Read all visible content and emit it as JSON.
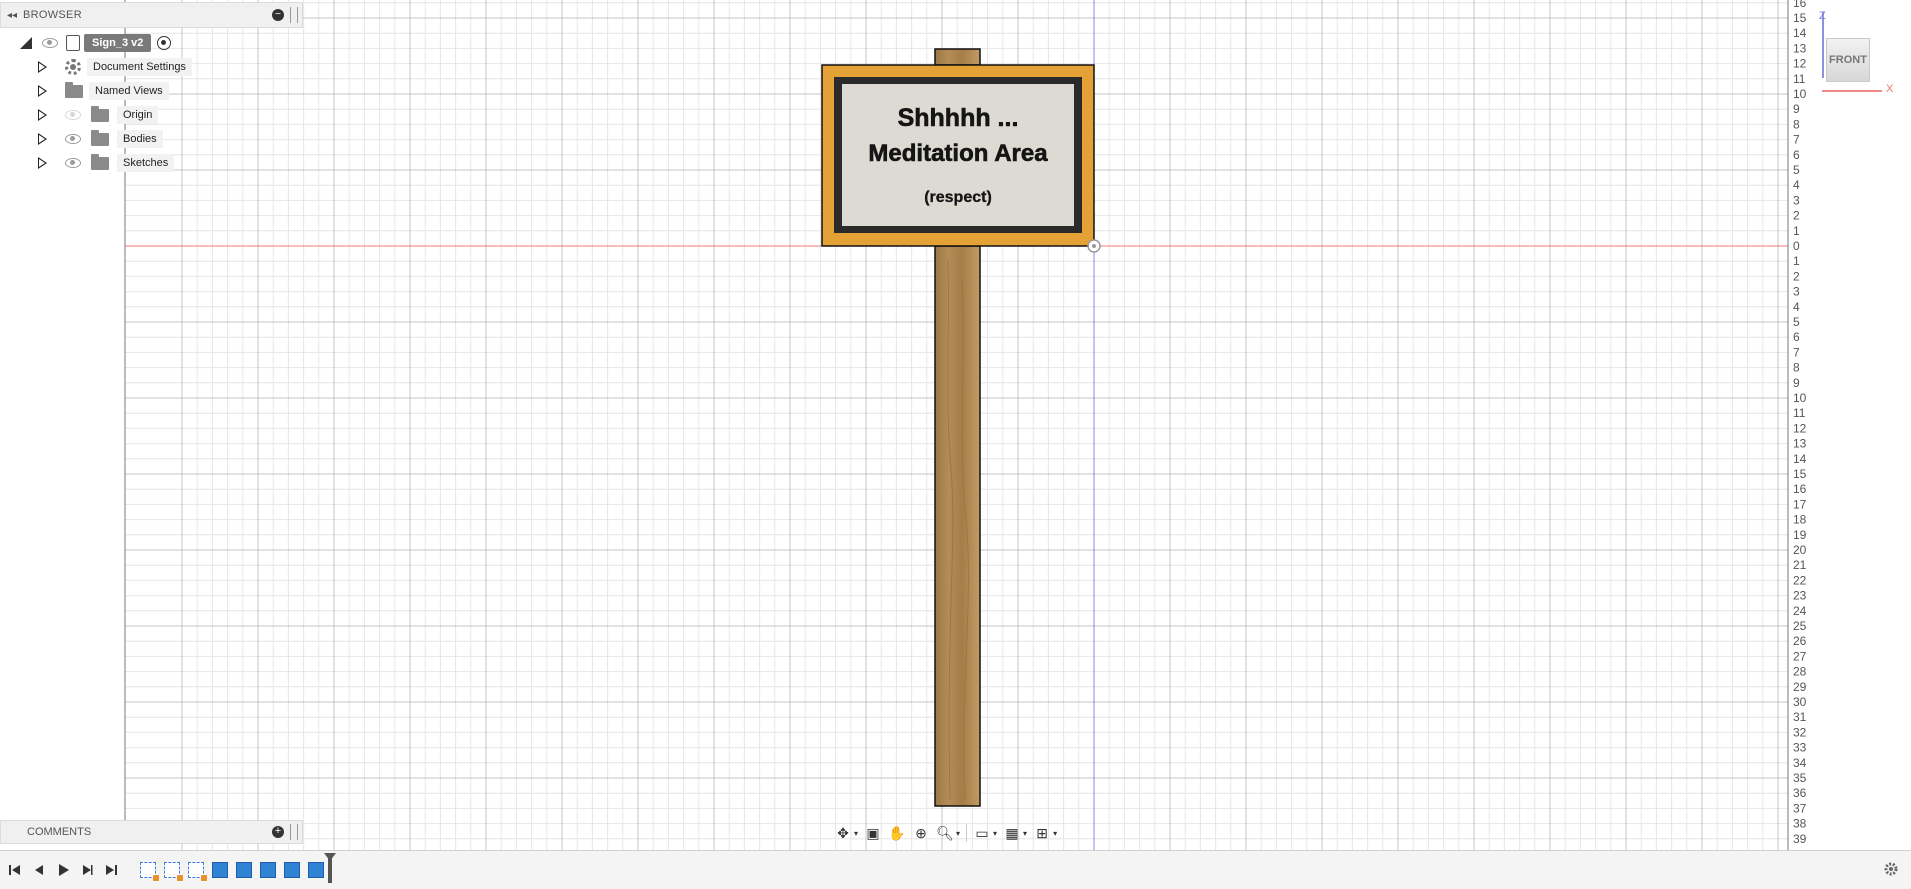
{
  "browser": {
    "title": "BROWSER",
    "root_label": "Sign_3 v2",
    "items": [
      {
        "label": "Document Settings",
        "icon": "gear-icon",
        "visible": null
      },
      {
        "label": "Named Views",
        "icon": "folder-icon",
        "visible": null
      },
      {
        "label": "Origin",
        "icon": "folder-icon",
        "visible": false
      },
      {
        "label": "Bodies",
        "icon": "folder-icon",
        "visible": true
      },
      {
        "label": "Sketches",
        "icon": "folder-icon",
        "visible": true
      }
    ]
  },
  "comments": {
    "title": "COMMENTS"
  },
  "sign": {
    "line1": "Shhhhh ...",
    "line2": "Meditation Area",
    "line3": "(respect)"
  },
  "viewcube": {
    "face": "FRONT",
    "axis_z": "Z",
    "axis_x": "X"
  },
  "ruler": {
    "up": [
      "16",
      "15",
      "14",
      "13",
      "12",
      "11",
      "10",
      "9",
      "8",
      "7",
      "6",
      "5",
      "4",
      "3",
      "2",
      "1",
      "0"
    ],
    "down": [
      "1",
      "2",
      "3",
      "4",
      "5",
      "6",
      "7",
      "8",
      "9",
      "10",
      "11",
      "12",
      "13",
      "14",
      "15",
      "16",
      "17",
      "18",
      "19",
      "20",
      "21",
      "22",
      "23",
      "24",
      "25",
      "26",
      "27",
      "28",
      "29",
      "30",
      "31",
      "32",
      "33",
      "34",
      "35",
      "36",
      "37",
      "38",
      "39"
    ]
  },
  "colors": {
    "frame_orange": "#e4a236",
    "frame_black": "#2a2a2a",
    "panel": "#dcdad2",
    "post_wood": "#b08a55",
    "axis_red": "#f07a7a",
    "axis_blue": "#8a8ae8",
    "grid_minor": "#e6e6e6",
    "grid_major": "#c4c4c4"
  },
  "nav_toolbar": [
    "orbit-icon",
    "look-at-icon",
    "pan-icon",
    "zoom-window-icon",
    "zoom-icon",
    "display-settings-icon",
    "grid-settings-icon",
    "viewports-icon"
  ],
  "timeline": {
    "controls": [
      "skip-start-icon",
      "step-back-icon",
      "play-icon",
      "step-forward-icon",
      "skip-end-icon"
    ],
    "features": [
      "sketch",
      "sketch",
      "sketch",
      "extrude",
      "extrude",
      "extrude",
      "extrude",
      "extrude"
    ]
  }
}
